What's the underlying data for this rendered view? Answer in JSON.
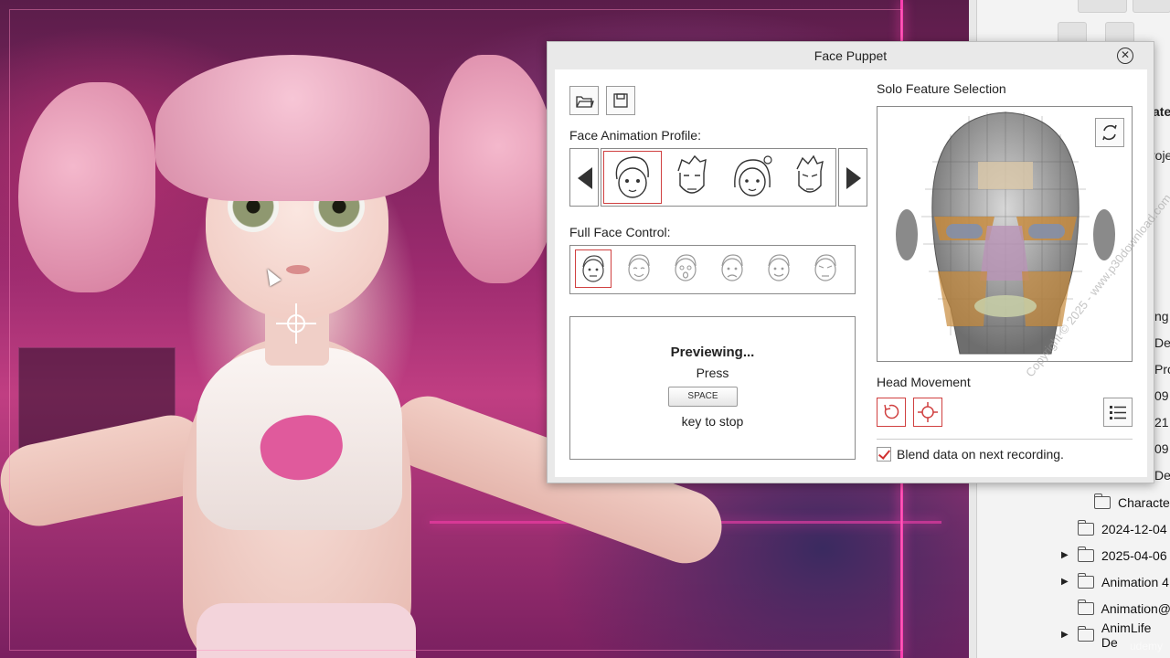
{
  "dialog": {
    "title": "Face Puppet",
    "open_tooltip": "",
    "face_animation_profile_label": "Face Animation Profile:",
    "full_face_control_label": "Full Face Control:",
    "solo_feature_label": "Solo Feature Selection",
    "head_movement_label": "Head Movement",
    "blend_label": "Blend data on next recording.",
    "blend_checked": true,
    "preview": {
      "title": "Previewing...",
      "press": "Press",
      "key": "SPACE",
      "suffix": "key to stop"
    },
    "profiles": [
      "profile-female-cute",
      "profile-male-stern",
      "profile-female-sketch",
      "profile-male-angry"
    ],
    "selected_profile": 0,
    "full_face_controls": [
      "face-neutral",
      "face-happy",
      "face-surprised",
      "face-sad",
      "face-smile",
      "face-angry"
    ],
    "selected_full_face": 0,
    "accent_color": "#d04040"
  },
  "right_panel": {
    "side_labels": [
      "ate",
      "roje",
      "ng",
      "Der",
      "Pro",
      "09",
      "21",
      "09",
      "De"
    ],
    "tree": [
      {
        "label": "Characte",
        "expand": false
      },
      {
        "label": "2024-12-04",
        "expand": false
      },
      {
        "label": "2025-04-06",
        "expand": true
      },
      {
        "label": "Animation 4",
        "expand": true
      },
      {
        "label": "Animation@",
        "expand": false
      },
      {
        "label": "AnimLife De",
        "expand": true
      }
    ]
  },
  "watermark": "Copyright © 2025 - www.p30download.com",
  "corner_brand": "udemy"
}
